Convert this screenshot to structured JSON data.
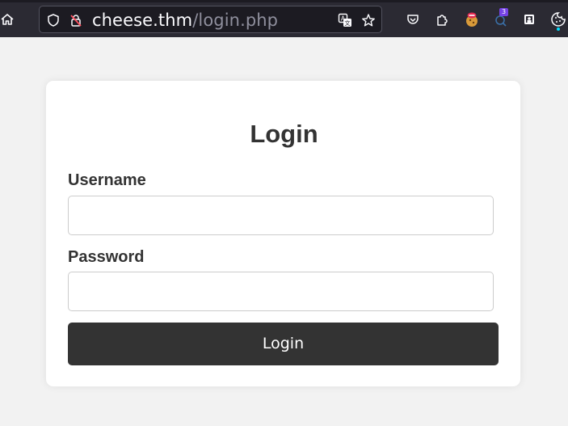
{
  "browser": {
    "url_host": "cheese.thm",
    "url_path": "/login.php",
    "extension_badge_count": "3",
    "icons": [
      "home-icon",
      "shield-icon",
      "insecure-lock-icon",
      "translate-icon",
      "bookmark-star-icon",
      "pocket-icon",
      "extensions-icon",
      "cookie-editor-icon",
      "extension-badge-icon",
      "container-icon",
      "cookie-icon"
    ],
    "colors": {
      "toolbar": "#2b2a33",
      "urlbar": "#1c1b22",
      "url_text": "#fbfbfe",
      "url_path": "#8f8f9d"
    }
  },
  "login": {
    "heading": "Login",
    "username_label": "Username",
    "username_value": "",
    "password_label": "Password",
    "password_value": "",
    "submit_label": "Login",
    "colors": {
      "page_bg": "#f2f2f2",
      "card_bg": "#ffffff",
      "text": "#333333",
      "button_bg": "#333333",
      "button_text": "#ffffff"
    }
  }
}
